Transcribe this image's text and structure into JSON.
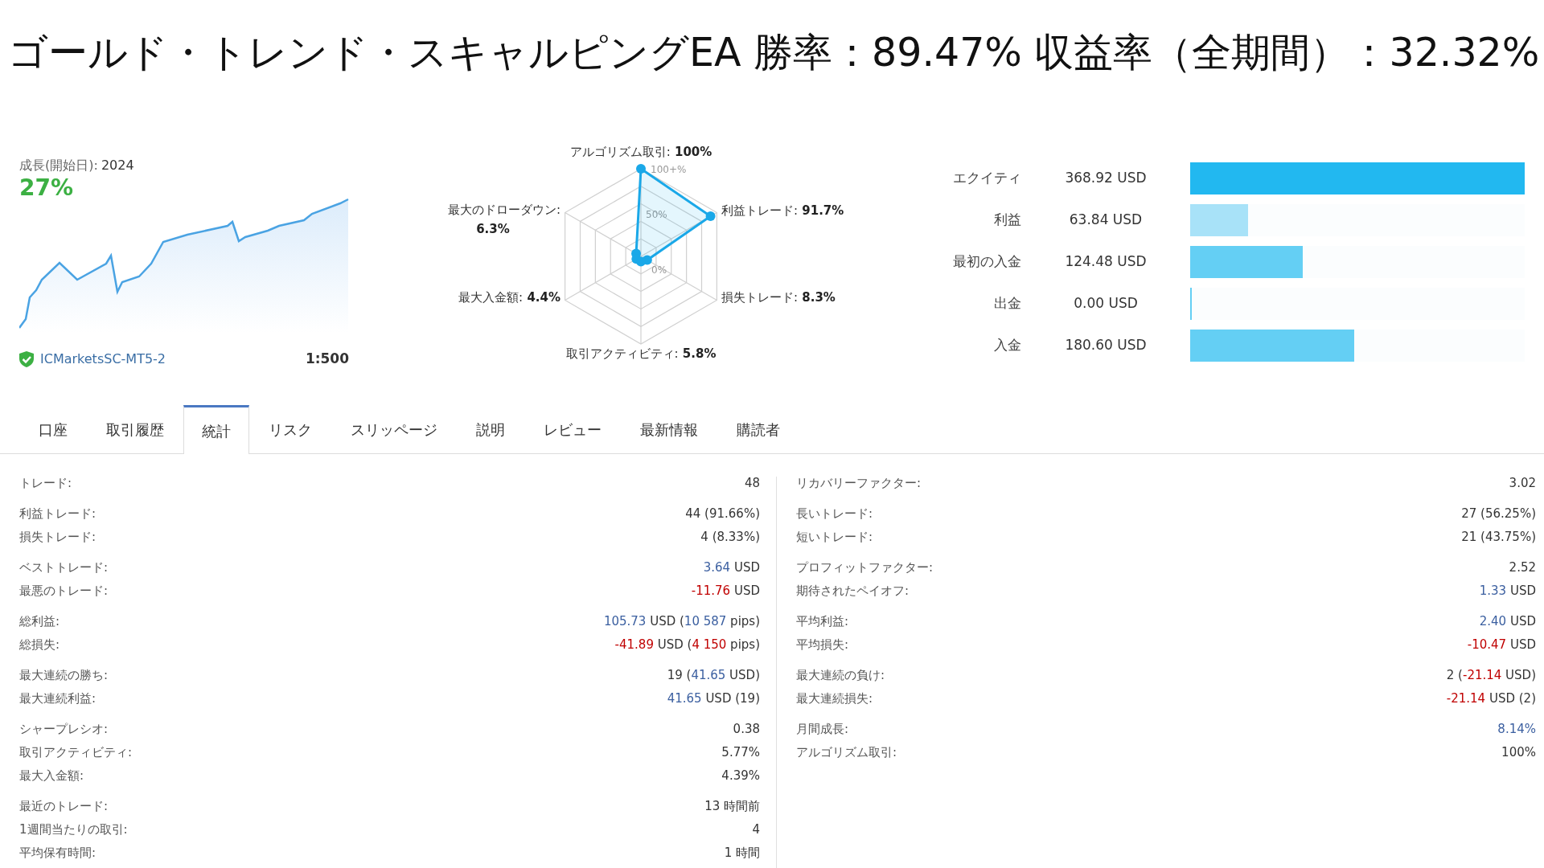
{
  "title": "ゴールド・トレンド・スキャルピングEA 勝率：89.47% 収益率（全期間）：32.32%",
  "growth": {
    "label": "成長(開始日):",
    "since": "2024",
    "value": "27%",
    "account": "ICMarketsSC-MT5-2",
    "leverage": "1:500"
  },
  "radar": {
    "grid_labels": [
      "100+%",
      "50%",
      "0%"
    ],
    "axes": [
      {
        "label": "アルゴリズム取引:",
        "reading": "100%",
        "level": 1.0,
        "kind": "inline"
      },
      {
        "label": "最大のドローダウン:",
        "reading": "6.3%",
        "level": 0.063,
        "kind": "two_line"
      },
      {
        "label": "利益トレード:",
        "reading": "91.7%",
        "level": 0.917,
        "kind": "inline"
      },
      {
        "label": "最大入金額:",
        "reading": "4.4%",
        "level": 0.044,
        "kind": "inline"
      },
      {
        "label": "損失トレード:",
        "reading": "8.3%",
        "level": 0.083,
        "kind": "inline"
      },
      {
        "label": "取引アクティビティ:",
        "reading": "5.8%",
        "level": 0.058,
        "kind": "inline"
      }
    ]
  },
  "balances": [
    {
      "label": "エクイティ",
      "value": "368.92 USD",
      "level": 1.0,
      "color": "#22b8f0"
    },
    {
      "label": "利益",
      "value": "63.84 USD",
      "level": 0.173,
      "color": "#a8e2f8"
    },
    {
      "label": "最初の入金",
      "value": "124.48 USD",
      "level": 0.337,
      "color": "#64cff4"
    },
    {
      "label": "出金",
      "value": "0.00 USD",
      "level": 0.0,
      "color": "#64cff4"
    },
    {
      "label": "入金",
      "value": "180.60 USD",
      "level": 0.49,
      "color": "#64cff4"
    }
  ],
  "tabs": [
    {
      "label": "口座",
      "selected": false
    },
    {
      "label": "取引履歴",
      "selected": false
    },
    {
      "label": "統計",
      "selected": true
    },
    {
      "label": "リスク",
      "selected": false
    },
    {
      "label": "スリッページ",
      "selected": false
    },
    {
      "label": "説明",
      "selected": false
    },
    {
      "label": "レビュー",
      "selected": false
    },
    {
      "label": "最新情報",
      "selected": false
    },
    {
      "label": "購読者",
      "selected": false
    }
  ],
  "stats_left": [
    [
      {
        "label": "トレード:",
        "value": [
          {
            "text": "48",
            "color": "#333333"
          }
        ]
      }
    ],
    [
      {
        "label": "利益トレード:",
        "value": [
          {
            "text": "44 (91.66%)",
            "color": "#333333"
          }
        ]
      },
      {
        "label": "損失トレード:",
        "value": [
          {
            "text": "4 (8.33%)",
            "color": "#333333"
          }
        ]
      }
    ],
    [
      {
        "label": "ベストトレード:",
        "value": [
          {
            "text": "3.64",
            "color": "#3b5fa0"
          },
          {
            "text": " USD",
            "color": "#333333"
          }
        ]
      },
      {
        "label": "最悪のトレード:",
        "value": [
          {
            "text": "-11.76",
            "color": "#c00000"
          },
          {
            "text": " USD",
            "color": "#333333"
          }
        ]
      }
    ],
    [
      {
        "label": "総利益:",
        "value": [
          {
            "text": "105.73",
            "color": "#3b5fa0"
          },
          {
            "text": " USD (",
            "color": "#333333"
          },
          {
            "text": "10 587",
            "color": "#3b5fa0"
          },
          {
            "text": " pips)",
            "color": "#333333"
          }
        ]
      },
      {
        "label": "総損失:",
        "value": [
          {
            "text": "-41.89",
            "color": "#c00000"
          },
          {
            "text": " USD (",
            "color": "#333333"
          },
          {
            "text": "4 150",
            "color": "#c00000"
          },
          {
            "text": " pips)",
            "color": "#333333"
          }
        ]
      }
    ],
    [
      {
        "label": "最大連続の勝ち:",
        "value": [
          {
            "text": "19 (",
            "color": "#333333"
          },
          {
            "text": "41.65",
            "color": "#3b5fa0"
          },
          {
            "text": " USD)",
            "color": "#333333"
          }
        ]
      },
      {
        "label": "最大連続利益:",
        "value": [
          {
            "text": "41.65",
            "color": "#3b5fa0"
          },
          {
            "text": " USD (19)",
            "color": "#333333"
          }
        ]
      }
    ],
    [
      {
        "label": "シャープレシオ:",
        "value": [
          {
            "text": "0.38",
            "color": "#333333"
          }
        ]
      },
      {
        "label": "取引アクティビティ:",
        "value": [
          {
            "text": "5.77%",
            "color": "#333333"
          }
        ]
      },
      {
        "label": "最大入金額:",
        "value": [
          {
            "text": "4.39%",
            "color": "#333333"
          }
        ]
      }
    ],
    [
      {
        "label": "最近のトレード:",
        "value": [
          {
            "text": "13 時間前",
            "color": "#333333"
          }
        ]
      },
      {
        "label": "1週間当たりの取引:",
        "value": [
          {
            "text": "4",
            "color": "#333333"
          }
        ]
      },
      {
        "label": "平均保有時間:",
        "value": [
          {
            "text": "1 時間",
            "color": "#333333"
          }
        ]
      }
    ]
  ],
  "stats_right": [
    [
      {
        "label": "リカバリーファクター:",
        "value": [
          {
            "text": "3.02",
            "color": "#333333"
          }
        ]
      }
    ],
    [
      {
        "label": "長いトレード:",
        "value": [
          {
            "text": "27 (56.25%)",
            "color": "#333333"
          }
        ]
      },
      {
        "label": "短いトレード:",
        "value": [
          {
            "text": "21 (43.75%)",
            "color": "#333333"
          }
        ]
      }
    ],
    [
      {
        "label": "プロフィットファクター:",
        "value": [
          {
            "text": "2.52",
            "color": "#333333"
          }
        ]
      },
      {
        "label": "期待されたペイオフ:",
        "value": [
          {
            "text": "1.33",
            "color": "#3b5fa0"
          },
          {
            "text": " USD",
            "color": "#333333"
          }
        ]
      }
    ],
    [
      {
        "label": "平均利益:",
        "value": [
          {
            "text": "2.40",
            "color": "#3b5fa0"
          },
          {
            "text": " USD",
            "color": "#333333"
          }
        ]
      },
      {
        "label": "平均損失:",
        "value": [
          {
            "text": "-10.47",
            "color": "#c00000"
          },
          {
            "text": " USD",
            "color": "#333333"
          }
        ]
      }
    ],
    [
      {
        "label": "最大連続の負け:",
        "value": [
          {
            "text": "2 (",
            "color": "#333333"
          },
          {
            "text": "-21.14",
            "color": "#c00000"
          },
          {
            "text": " USD)",
            "color": "#333333"
          }
        ]
      },
      {
        "label": "最大連続損失:",
        "value": [
          {
            "text": "-21.14",
            "color": "#c00000"
          },
          {
            "text": " USD (2)",
            "color": "#333333"
          }
        ]
      }
    ],
    [
      {
        "label": "月間成長:",
        "value": [
          {
            "text": "8.14%",
            "color": "#3b5fa0"
          }
        ]
      },
      {
        "label": "アルゴリズム取引:",
        "value": [
          {
            "text": "100%",
            "color": "#333333"
          }
        ]
      }
    ]
  ]
}
